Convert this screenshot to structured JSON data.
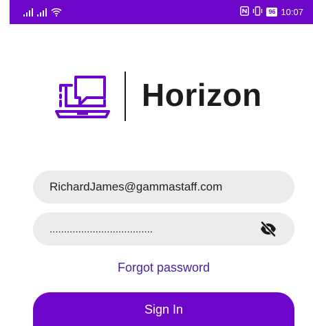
{
  "status_bar": {
    "battery": "96",
    "time": "10:07"
  },
  "brand": {
    "name": "Horizon"
  },
  "login_form": {
    "email_value": "RichardJames@gammastaff.com",
    "password_value": "....................................",
    "forgot_label": "Forgot password",
    "signin_label": "Sign In"
  },
  "colors": {
    "primary": "#6d06c9",
    "link": "#4a1e9c",
    "field_bg": "#ececec",
    "text_dark": "#1c1c1c"
  },
  "icons": {
    "signal": "signal-bars-icon",
    "wifi": "wifi-icon",
    "nfc": "nfc-icon",
    "vibrate": "vibrate-icon",
    "visibility": "eye-off-icon",
    "logo": "chat-laptop-logo-icon"
  }
}
